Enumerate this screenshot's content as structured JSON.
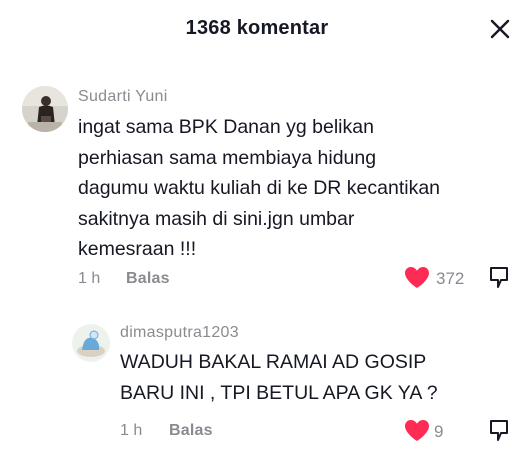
{
  "header": {
    "title": "1368 komentar",
    "close_icon": "close-icon"
  },
  "comments": [
    {
      "username": "Sudarti Yuni",
      "text": "ingat sama BPK Danan yg belikan\nperhiasan sama membiaya hidung\ndagumu waktu kuliah di ke DR kecantikan\nsakitnya masih di sini.jgn umbar\nkemesraan !!!",
      "time": "1 h",
      "reply_label": "Balas",
      "likes": "372",
      "liked": true
    },
    {
      "username": "dimasputra1203",
      "text": "WADUH BAKAL RAMAI AD GOSIP\nBARU INI , TPI BETUL APA GK YA ?",
      "time": "1 h",
      "reply_label": "Balas",
      "likes": "9",
      "liked": true
    }
  ],
  "colors": {
    "heart": "#fe2c55",
    "muted": "#8a8b91",
    "text": "#161823"
  }
}
